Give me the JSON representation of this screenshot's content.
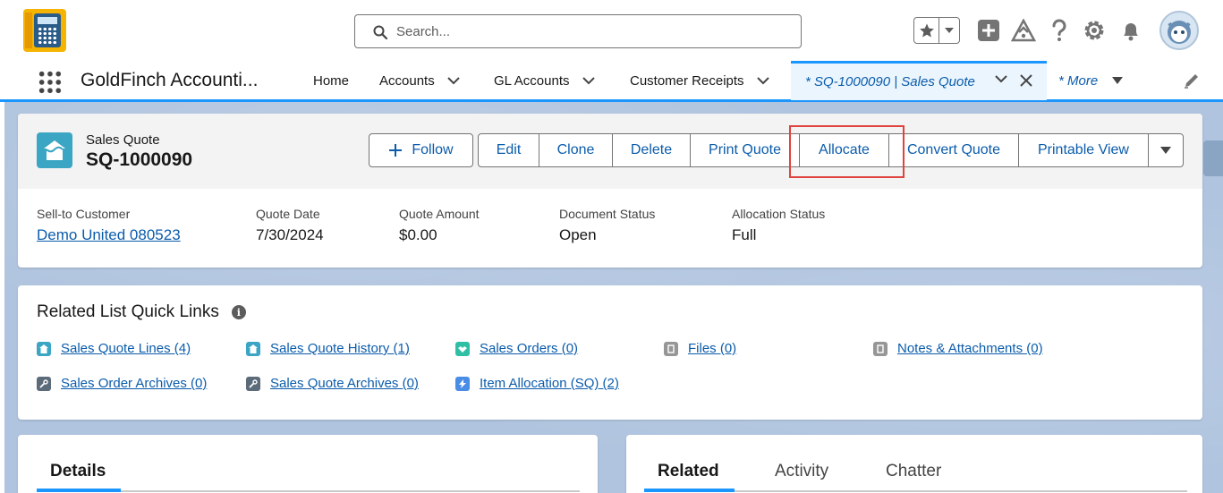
{
  "header": {
    "search_placeholder": "Search...",
    "icons": [
      "search-icon",
      "star-icon",
      "chevron-down-icon",
      "add-icon",
      "trailhead-icon",
      "help-icon",
      "gear-icon",
      "bell-icon",
      "avatar"
    ]
  },
  "nav": {
    "app_name": "GoldFinch Accounti...",
    "items": [
      {
        "label": "Home"
      },
      {
        "label": "Accounts"
      },
      {
        "label": "GL Accounts"
      },
      {
        "label": "Customer Receipts"
      }
    ],
    "active_tab": "* SQ-1000090 | Sales Quote",
    "more": "* More"
  },
  "record": {
    "object_label": "Sales Quote",
    "title": "SQ-1000090",
    "follow": "Follow",
    "actions": [
      "Edit",
      "Clone",
      "Delete",
      "Print Quote",
      "Allocate",
      "Convert Quote",
      "Printable View"
    ],
    "fields": [
      {
        "label": "Sell-to Customer",
        "value": "Demo United 080523"
      },
      {
        "label": "Quote Date",
        "value": "7/30/2024"
      },
      {
        "label": "Quote Amount",
        "value": "$0.00"
      },
      {
        "label": "Document Status",
        "value": "Open"
      },
      {
        "label": "Allocation Status",
        "value": "Full"
      }
    ]
  },
  "quick_links": {
    "title": "Related List Quick Links",
    "links": [
      {
        "label": "Sales Quote Lines (4)",
        "icon": "sales-quote-icon"
      },
      {
        "label": "Sales Quote History (1)",
        "icon": "sales-quote-icon"
      },
      {
        "label": "Sales Orders (0)",
        "icon": "handshake-icon"
      },
      {
        "label": "Files (0)",
        "icon": "files-icon"
      },
      {
        "label": "Notes & Attachments (0)",
        "icon": "notes-icon"
      },
      {
        "label": "Sales Order Archives (0)",
        "icon": "wrench-icon"
      },
      {
        "label": "Sales Quote Archives (0)",
        "icon": "wrench-icon"
      },
      {
        "label": "Item Allocation (SQ) (2)",
        "icon": "lightning-icon"
      }
    ]
  },
  "details_tabs": [
    "Details"
  ],
  "related_tabs": [
    "Related",
    "Activity",
    "Chatter"
  ],
  "colors": {
    "brand_blue": "#0b5cab",
    "active_blue": "#1b96ff",
    "highlight_red": "#e0433d",
    "record_icon": "#3ba5c4"
  }
}
